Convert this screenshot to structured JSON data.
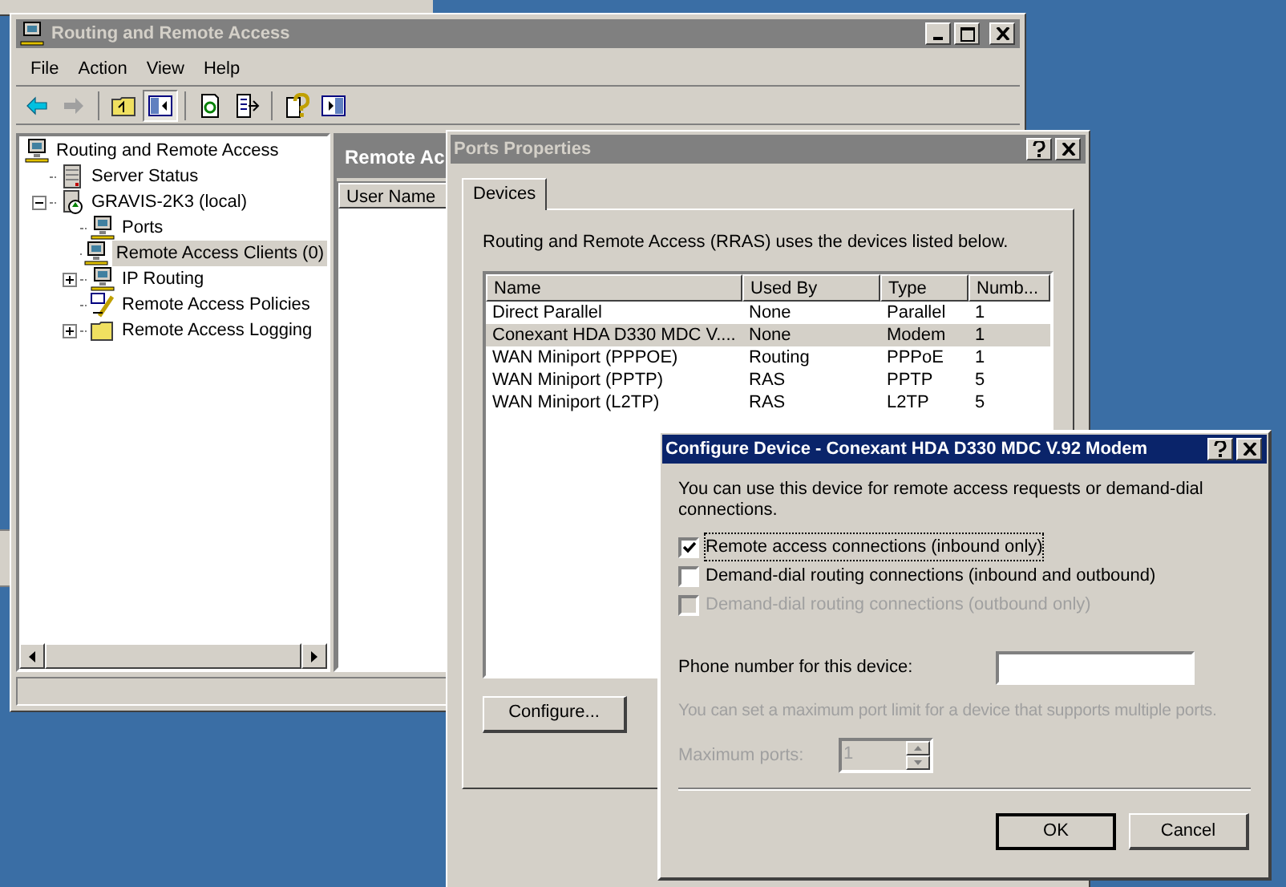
{
  "main_window": {
    "title": "Routing and Remote Access",
    "active": false,
    "menu": [
      "File",
      "Action",
      "View",
      "Help"
    ],
    "tree": [
      {
        "label": "Routing and Remote Access",
        "kind": "root",
        "selected": false,
        "children": [
          {
            "label": "Server Status",
            "kind": "server",
            "selected": false
          },
          {
            "label": "GRAVIS-2K3 (local)",
            "kind": "computer",
            "selected": false,
            "expanded": true,
            "children": [
              {
                "label": "Ports",
                "kind": "network",
                "selected": false
              },
              {
                "label": "Remote Access Clients (0)",
                "kind": "network",
                "selected": true
              },
              {
                "label": "IP Routing",
                "kind": "network",
                "selected": false,
                "expanded": false
              },
              {
                "label": "Remote Access Policies",
                "kind": "policy",
                "selected": false
              },
              {
                "label": "Remote Access Logging",
                "kind": "folder",
                "selected": false,
                "expanded": false
              }
            ]
          }
        ]
      }
    ],
    "right_pane": {
      "header": "Remote Ac",
      "columns": [
        "User Name"
      ]
    }
  },
  "ports_dialog": {
    "title": "Ports Properties",
    "active": false,
    "tabs": [
      {
        "label": "Devices",
        "selected": true
      }
    ],
    "intro": "Routing and Remote Access (RRAS) uses the devices listed below.",
    "columns": [
      "Name",
      "Used By",
      "Type",
      "Numb..."
    ],
    "rows": [
      {
        "cells": [
          "Direct Parallel",
          "None",
          "Parallel",
          "1"
        ],
        "selected": false
      },
      {
        "cells": [
          "Conexant HDA D330 MDC V....",
          "None",
          "Modem",
          "1"
        ],
        "selected": true
      },
      {
        "cells": [
          "WAN Miniport (PPPOE)",
          "Routing",
          "PPPoE",
          "1"
        ],
        "selected": false
      },
      {
        "cells": [
          "WAN Miniport (PPTP)",
          "RAS",
          "PPTP",
          "5"
        ],
        "selected": false
      },
      {
        "cells": [
          "WAN Miniport (L2TP)",
          "RAS",
          "L2TP",
          "5"
        ],
        "selected": false
      }
    ],
    "button": "Configure..."
  },
  "configure_dialog": {
    "title": "Configure Device - Conexant HDA D330 MDC V.92 Modem",
    "active": true,
    "description": "You can use this device for remote access requests or demand-dial connections.",
    "options": [
      {
        "label": "Remote access connections (inbound only)",
        "checked": true,
        "disabled": false
      },
      {
        "label": "Demand-dial routing connections (inbound and outbound)",
        "checked": false,
        "disabled": false
      },
      {
        "label": "Demand-dial routing connections (outbound only)",
        "checked": false,
        "disabled": true
      }
    ],
    "phone_label": "Phone number for this device:",
    "port_note": "You can set a maximum port limit for a device that supports multiple ports.",
    "max_ports": {
      "label": "Maximum ports:",
      "value": "1",
      "disabled": true
    },
    "buttons": [
      "OK",
      "Cancel"
    ]
  }
}
